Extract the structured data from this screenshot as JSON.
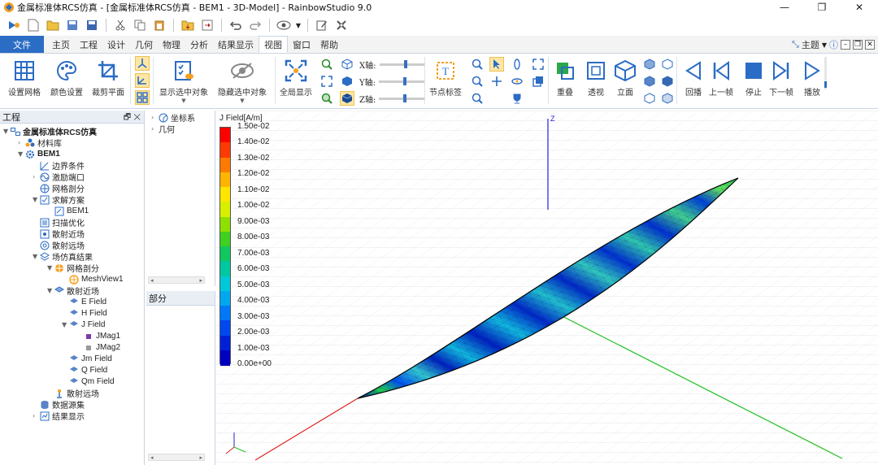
{
  "window": {
    "title": "金属标准体RCS仿真 - [金属标准体RCS仿真 - BEM1 - 3D-Model] - RainbowStudio 9.0",
    "buttons": [
      "minimize",
      "restore",
      "close"
    ]
  },
  "menu": {
    "tabs": [
      "文件",
      "主页",
      "工程",
      "设计",
      "几何",
      "物理",
      "分析",
      "结果显示",
      "视图",
      "窗口",
      "帮助"
    ],
    "active": "视图",
    "theme_label": "主题"
  },
  "ribbon": {
    "mesh_settings": "设置网格",
    "color_settings": "颜色设置",
    "clip_plane": "裁剪平面",
    "show_selected": "显示选中对象",
    "hide_selected": "隐藏选中对象",
    "fit_all": "全局显示",
    "x_axis": "X轴:",
    "y_axis": "Y轴:",
    "z_axis": "Z轴:",
    "node_label": "节点标签",
    "overlap": "重叠",
    "perspective": "透视",
    "elevation": "立面",
    "playback": "回播",
    "prev_frame": "上一帧",
    "stop": "停止",
    "next_frame": "下一帧",
    "play": "播放"
  },
  "project_panel": {
    "title": "工程",
    "tree": {
      "root": "金属标准体RCS仿真",
      "material_lib": "材料库",
      "bem1": "BEM1",
      "boundary": "边界条件",
      "excitation": "激励端口",
      "mesh": "网格剖分",
      "solve_plan": "求解方案",
      "bem1_sub": "BEM1",
      "sweep": "扫描优化",
      "scatter_near": "散射近场",
      "scatter_far": "散射远场",
      "field_results": "场仿真结果",
      "mesh_result": "网格剖分",
      "meshview": "MeshView1",
      "near_field": "散射近场",
      "e_field": "E Field",
      "h_field": "H Field",
      "j_field": "J Field",
      "jmag1": "JMag1",
      "jmag2": "JMag2",
      "jm_field": "Jm Field",
      "q_field": "Q Field",
      "qm_field": "Qm Field",
      "far_field": "散射远场",
      "dataset": "数据源集",
      "results_display": "结果显示"
    }
  },
  "coord_panel": {
    "items": [
      "坐标系",
      "几何"
    ]
  },
  "part_panel": {
    "title": "部分"
  },
  "viewport": {
    "legend_title": "J Field[A/m]",
    "legend_values": [
      "1.50e-02",
      "1.40e-02",
      "1.30e-02",
      "1.20e-02",
      "1.10e-02",
      "1.00e-02",
      "9.00e-03",
      "8.00e-03",
      "7.00e-03",
      "6.00e-03",
      "5.00e-03",
      "4.00e-03",
      "3.00e-03",
      "2.00e-03",
      "1.00e-03",
      "0.00e+00"
    ],
    "legend_colors": [
      "#ff0000",
      "#ff3a00",
      "#ff7a00",
      "#ffb400",
      "#ffe600",
      "#d8f000",
      "#8ee000",
      "#3fd020",
      "#10c860",
      "#00c8a0",
      "#00c8d8",
      "#00a8f0",
      "#0078f8",
      "#0048f0",
      "#0020d8",
      "#0000c0"
    ],
    "axis_z": "Z",
    "axis_colors": {
      "x": "#e02020",
      "y": "#20c020",
      "z": "#2020e0"
    }
  }
}
